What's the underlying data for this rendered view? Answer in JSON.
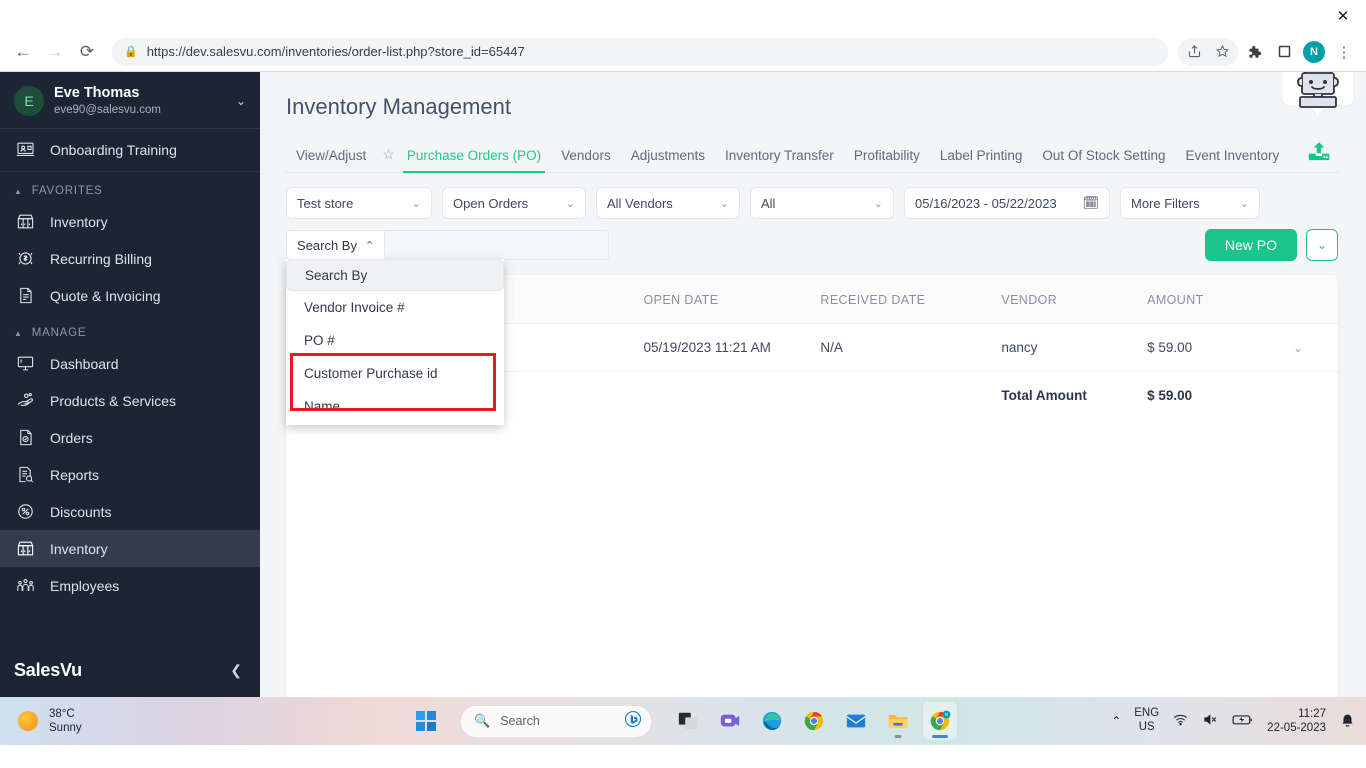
{
  "browser": {
    "url": "https://dev.salesvu.com/inventories/order-list.php?store_id=65447",
    "back_icon": "back-arrow-icon",
    "forward_icon": "forward-arrow-icon",
    "reload_icon": "reload-icon",
    "lock_icon": "lock-icon",
    "share_icon": "share-icon",
    "bookmark_icon": "star-icon",
    "extensions_icon": "puzzle-icon",
    "sidepanel_icon": "side-panel-icon",
    "profile_initial": "N",
    "menu_icon": "kebab-menu-icon",
    "close_icon": "close-icon"
  },
  "sidebar": {
    "user": {
      "initial": "E",
      "name": "Eve Thomas",
      "email": "eve90@salesvu.com"
    },
    "onboarding": {
      "label": "Onboarding Training",
      "icon": "training-icon"
    },
    "favorites_label": "FAVORITES",
    "favorites": [
      {
        "label": "Inventory",
        "icon": "store-icon"
      },
      {
        "label": "Recurring Billing",
        "icon": "recurring-billing-icon"
      },
      {
        "label": "Quote & Invoicing",
        "icon": "invoice-icon"
      }
    ],
    "manage_label": "MANAGE",
    "manage": [
      {
        "label": "Dashboard",
        "icon": "monitor-icon"
      },
      {
        "label": "Products & Services",
        "icon": "products-icon"
      },
      {
        "label": "Orders",
        "icon": "orders-icon"
      },
      {
        "label": "Reports",
        "icon": "reports-icon"
      },
      {
        "label": "Discounts",
        "icon": "percent-icon"
      },
      {
        "label": "Inventory",
        "icon": "store-icon"
      },
      {
        "label": "Employees",
        "icon": "employees-icon"
      }
    ],
    "brand": "SalesVu",
    "collapse_icon": "chevron-left-icon"
  },
  "main": {
    "title": "Inventory Management",
    "star_icon": "star-outline-icon",
    "upload_icon": "upload-icon",
    "assistant_icon": "robot-icon",
    "tabs": [
      {
        "label": "View/Adjust",
        "active": false
      },
      {
        "label": "Purchase Orders (PO)",
        "active": true
      },
      {
        "label": "Vendors",
        "active": false
      },
      {
        "label": "Adjustments",
        "active": false
      },
      {
        "label": "Inventory Transfer",
        "active": false
      },
      {
        "label": "Profitability",
        "active": false
      },
      {
        "label": "Label Printing",
        "active": false
      },
      {
        "label": "Out Of Stock Setting",
        "active": false
      },
      {
        "label": "Event Inventory",
        "active": false
      }
    ],
    "filters": {
      "store": "Test store",
      "status": "Open Orders",
      "vendor": "All Vendors",
      "all": "All",
      "date_range": "05/16/2023 - 05/22/2023",
      "calendar_icon": "calendar-icon",
      "more_filters": "More Filters"
    },
    "search": {
      "button_label": "Search By",
      "caret_icon": "chevron-up-icon",
      "input_value": "",
      "placeholder": ""
    },
    "search_dropdown": {
      "options": [
        {
          "label": "Search By",
          "selected": true
        },
        {
          "label": "Vendor Invoice #",
          "selected": false
        },
        {
          "label": "PO #",
          "selected": false
        },
        {
          "label": "Customer Purchase id",
          "selected": false
        },
        {
          "label": "Name",
          "selected": false
        }
      ],
      "highlight_color": "#e81b23"
    },
    "actions": {
      "new_po": "New PO",
      "new_po_caret_icon": "chevron-down-icon",
      "accent_color": "#19c58a"
    },
    "table": {
      "columns": [
        "",
        "",
        "OPEN DATE",
        "RECEIVED DATE",
        "VENDOR",
        "AMOUNT",
        ""
      ],
      "rows": [
        {
          "c0": "",
          "c1": "",
          "open_date": "05/19/2023 11:21 AM",
          "received_date": "N/A",
          "vendor": "nancy",
          "amount": "$ 59.00",
          "row_caret_icon": "chevron-down-icon"
        }
      ],
      "total_label": "Total Amount",
      "total_amount": "$ 59.00"
    }
  },
  "taskbar": {
    "weather_temp": "38°C",
    "weather_cond": "Sunny",
    "weather_icon": "sun-icon",
    "start_icon": "windows-start-icon",
    "search_placeholder": "Search",
    "search_icon": "search-icon",
    "bing_icon": "bing-chat-icon",
    "apps": [
      {
        "name": "task-view-icon"
      },
      {
        "name": "teams-icon"
      },
      {
        "name": "edge-icon"
      },
      {
        "name": "chrome-icon"
      },
      {
        "name": "mail-icon"
      },
      {
        "name": "file-explorer-icon"
      },
      {
        "name": "chrome-active-icon"
      }
    ],
    "tray": {
      "chevron_icon": "chevron-up-icon",
      "lang_line1": "ENG",
      "lang_line2": "US",
      "wifi_icon": "wifi-icon",
      "volume_icon": "volume-muted-icon",
      "battery_icon": "battery-charging-icon",
      "time": "11:27",
      "date": "22-05-2023",
      "notify_icon": "notification-icon"
    }
  }
}
